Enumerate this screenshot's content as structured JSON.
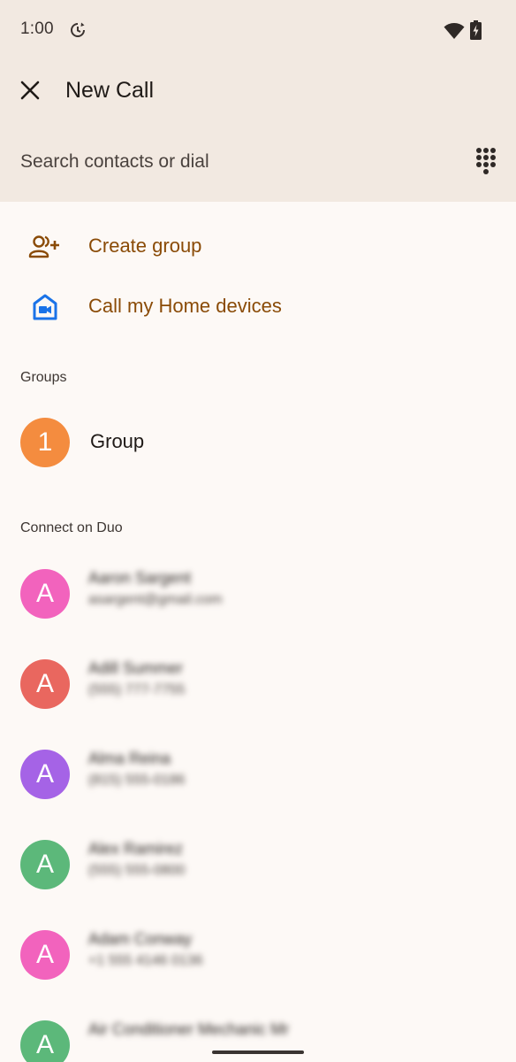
{
  "status_bar": {
    "time": "1:00",
    "icons": [
      "sync-icon",
      "wifi-icon",
      "battery-charging-icon"
    ]
  },
  "header": {
    "title": "New Call",
    "close_icon": "close-icon",
    "search_placeholder": "Search contacts or dial",
    "dialpad_icon": "dialpad-icon"
  },
  "actions": [
    {
      "label": "Create group",
      "icon": "add-group-icon"
    },
    {
      "label": "Call my Home devices",
      "icon": "home-video-icon"
    }
  ],
  "groups": {
    "header": "Groups",
    "items": [
      {
        "initial": "1",
        "name": "Group",
        "color": "#f48c3f"
      }
    ]
  },
  "duo": {
    "header": "Connect on Duo",
    "contacts": [
      {
        "initial": "A",
        "name": "Aaron Sargent",
        "detail": "asargent@gmail.com",
        "color": "#f263bd"
      },
      {
        "initial": "A",
        "name": "Adill Summer",
        "detail": "(555) 777-7755",
        "color": "#e9675f"
      },
      {
        "initial": "A",
        "name": "Alma Reina",
        "detail": "(815) 555-0186",
        "color": "#a563e6"
      },
      {
        "initial": "A",
        "name": "Alex Ramirez",
        "detail": "(555) 555-0800",
        "color": "#5cb87a"
      },
      {
        "initial": "A",
        "name": "Adam Conway",
        "detail": "+1 555 4146 0136",
        "color": "#f263bd"
      },
      {
        "initial": "A",
        "name": "Air Conditioner Mechanic Mr",
        "detail": "",
        "color": "#5cb87a"
      }
    ]
  },
  "colors": {
    "header_bg": "#f2e9e1",
    "page_bg": "#fdf9f6",
    "accent": "#8a4b07",
    "home_icon": "#1a73e8"
  }
}
